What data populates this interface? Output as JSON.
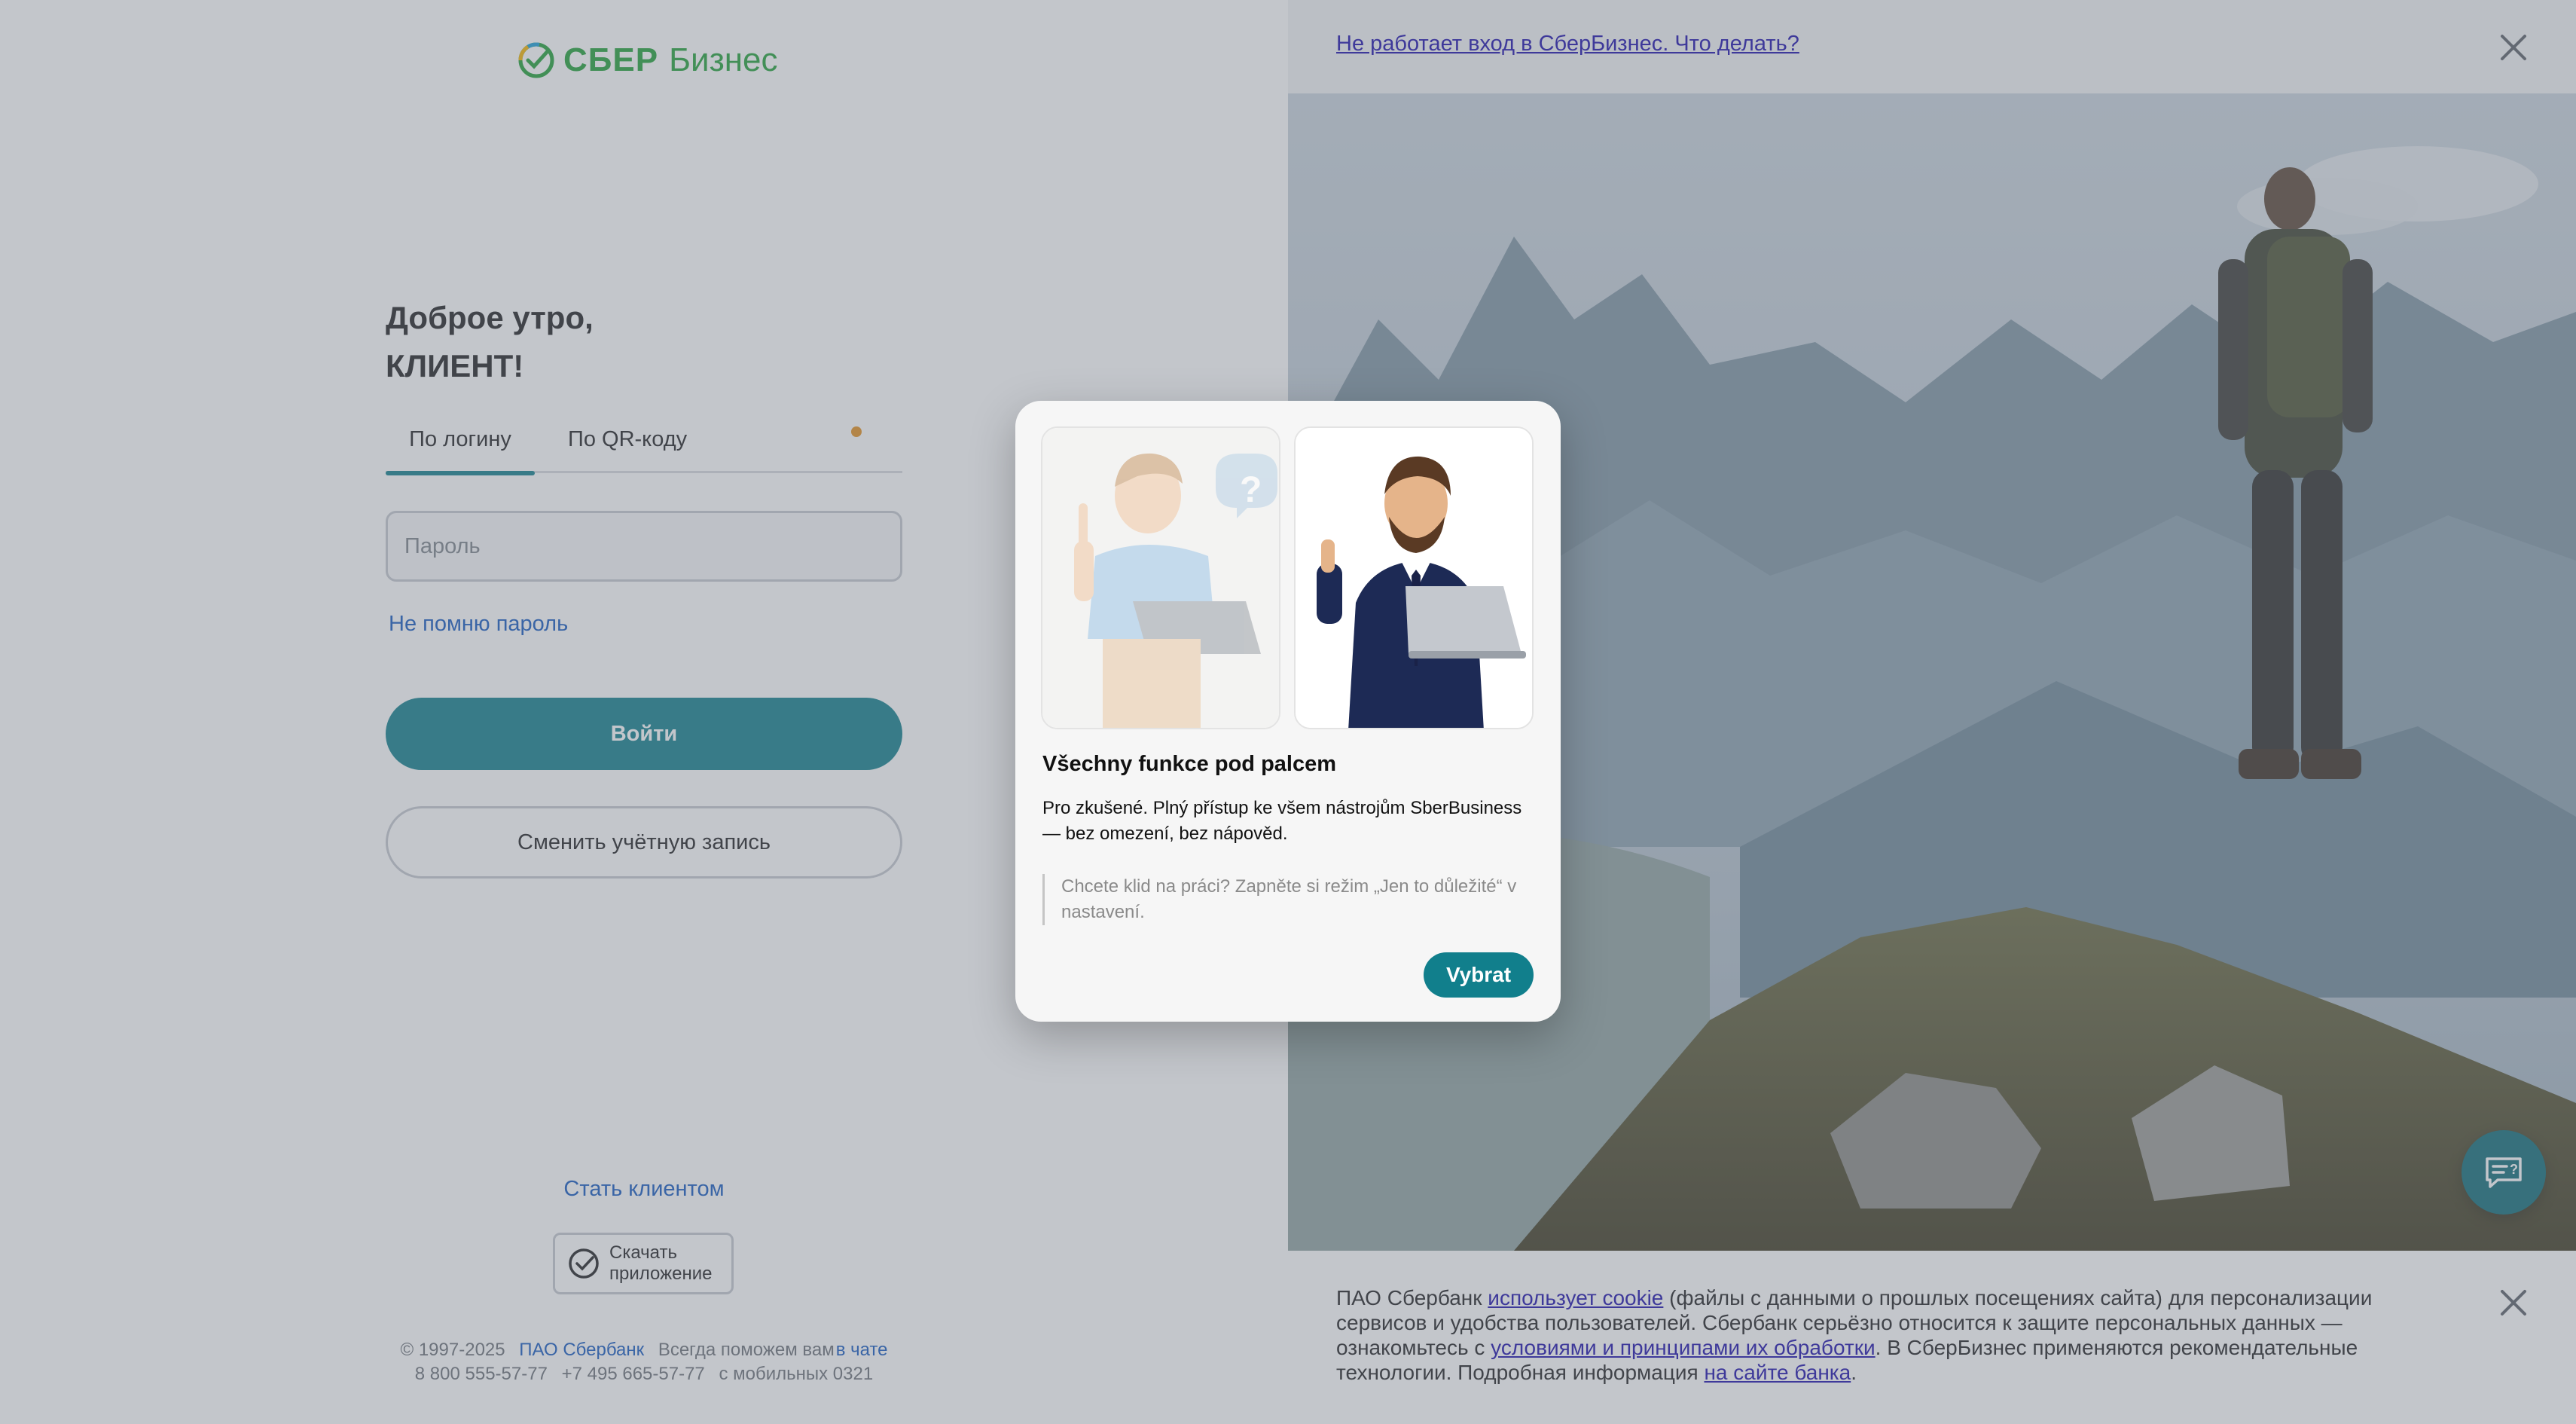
{
  "brand": {
    "sber": "СБЕР",
    "biz": "Бизнес"
  },
  "login": {
    "greeting_line1": "Доброе утро,",
    "greeting_line2": "КЛИЕНТ!",
    "tab_login": "По логину",
    "tab_qr": "По QR-коду",
    "password_placeholder": "Пароль",
    "forgot": "Не помню пароль",
    "login_button": "Войти",
    "switch_button": "Сменить учётную запись"
  },
  "footer": {
    "become_client": "Стать клиентом",
    "download_line1": "Скачать",
    "download_line2": "приложение",
    "copyright": "© 1997-2025",
    "bank_link": "ПАО Сбербанк",
    "help_text": "Всегда поможем вам",
    "chat_link": "в чате",
    "phone1": "8 800 555-57-77",
    "phone2": "+7 495 665-57-77",
    "mobile": "с мобильных 0321"
  },
  "right": {
    "top_link": "Не работает вход в СберБизнес. Что делать?",
    "cookie_part1": "ПАО Сбербанк ",
    "cookie_link1": "использует cookie",
    "cookie_part2": " (файлы с данными о прошлых посещениях сайта) для персонализации сервисов и удобства пользователей. Сбербанк серьёзно относится к защите персональных данных — ознакомьтесь с ",
    "cookie_link2": "условиями и принципами их обработки",
    "cookie_part3": ". В СберБизнес применяются рекомендательные технологии. Подробная информация ",
    "cookie_link3": "на сайте банка",
    "cookie_part4": "."
  },
  "modal": {
    "title": "Všechny funkce pod palcem",
    "description": "Pro zkušené. Plný přístup ke všem nástrojům SberBusiness — bez omezení, bez nápověd.",
    "quote": "Chcete klid na práci? Zapněte si režim „Jen to důležité“ v nastavení.",
    "button": "Vybrat"
  },
  "colors": {
    "accent": "#107f8c",
    "brand_green": "#21a038",
    "link": "#1358bf",
    "notification_dot": "#e3901e"
  },
  "icons": [
    "sber-logo-icon",
    "close-icon",
    "chat-help-icon",
    "app-logo-icon"
  ]
}
